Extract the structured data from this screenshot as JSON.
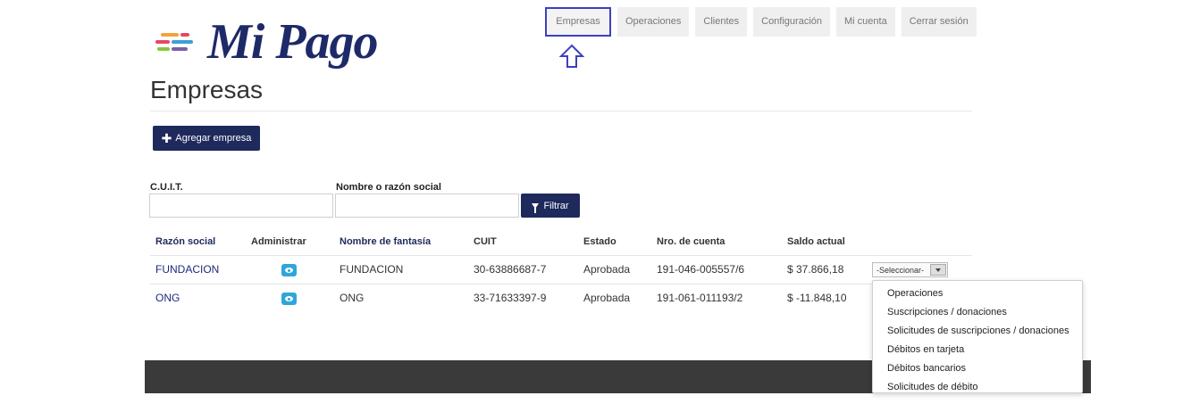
{
  "brand": {
    "name": "Mi Pago",
    "stripe_colors": [
      "#f2a23a",
      "#e8475f",
      "#8ac53f",
      "#7b5ea7",
      "#3aa0d8"
    ]
  },
  "nav": {
    "items": [
      {
        "label": "Empresas",
        "active": true
      },
      {
        "label": "Operaciones"
      },
      {
        "label": "Clientes"
      },
      {
        "label": "Configuración"
      },
      {
        "label": "Mi cuenta"
      },
      {
        "label": "Cerrar sesión"
      }
    ],
    "highlight_color": "#3d3fc0"
  },
  "page": {
    "title": "Empresas"
  },
  "toolbar": {
    "add_label": "Agregar empresa"
  },
  "filters": {
    "cuit_label": "C.U.I.T.",
    "cuit_value": "",
    "name_label": "Nombre o razón social",
    "name_value": "",
    "filter_label": "Filtrar"
  },
  "table": {
    "headers": [
      "Razón social",
      "Administrar",
      "Nombre de fantasía",
      "CUIT",
      "Estado",
      "Nro. de cuenta",
      "Saldo actual"
    ],
    "rows": [
      {
        "razon_social": "FUNDACION",
        "fantasia": "FUNDACION",
        "cuit": "30-63886687-7",
        "estado": "Aprobada",
        "cuenta": "191-046-005557/6",
        "saldo": "$ 37.866,18"
      },
      {
        "razon_social": "ONG",
        "fantasia": "ONG",
        "cuit": "33-71633397-9",
        "estado": "Aprobada",
        "cuenta": "191-061-011193/2",
        "saldo": "$ -11.848,10"
      }
    ],
    "select_value": "-Seleccionar-"
  },
  "dropdown": {
    "options": [
      "Operaciones",
      "Suscripciones / donaciones",
      "Solicitudes de suscripciones / donaciones",
      "Débitos en tarjeta",
      "Débitos bancarios",
      "Solicitudes de débito"
    ]
  },
  "colors": {
    "primary": "#1e2a5c",
    "eye_button": "#2fa6d9",
    "footer": "#3a3a3a"
  }
}
